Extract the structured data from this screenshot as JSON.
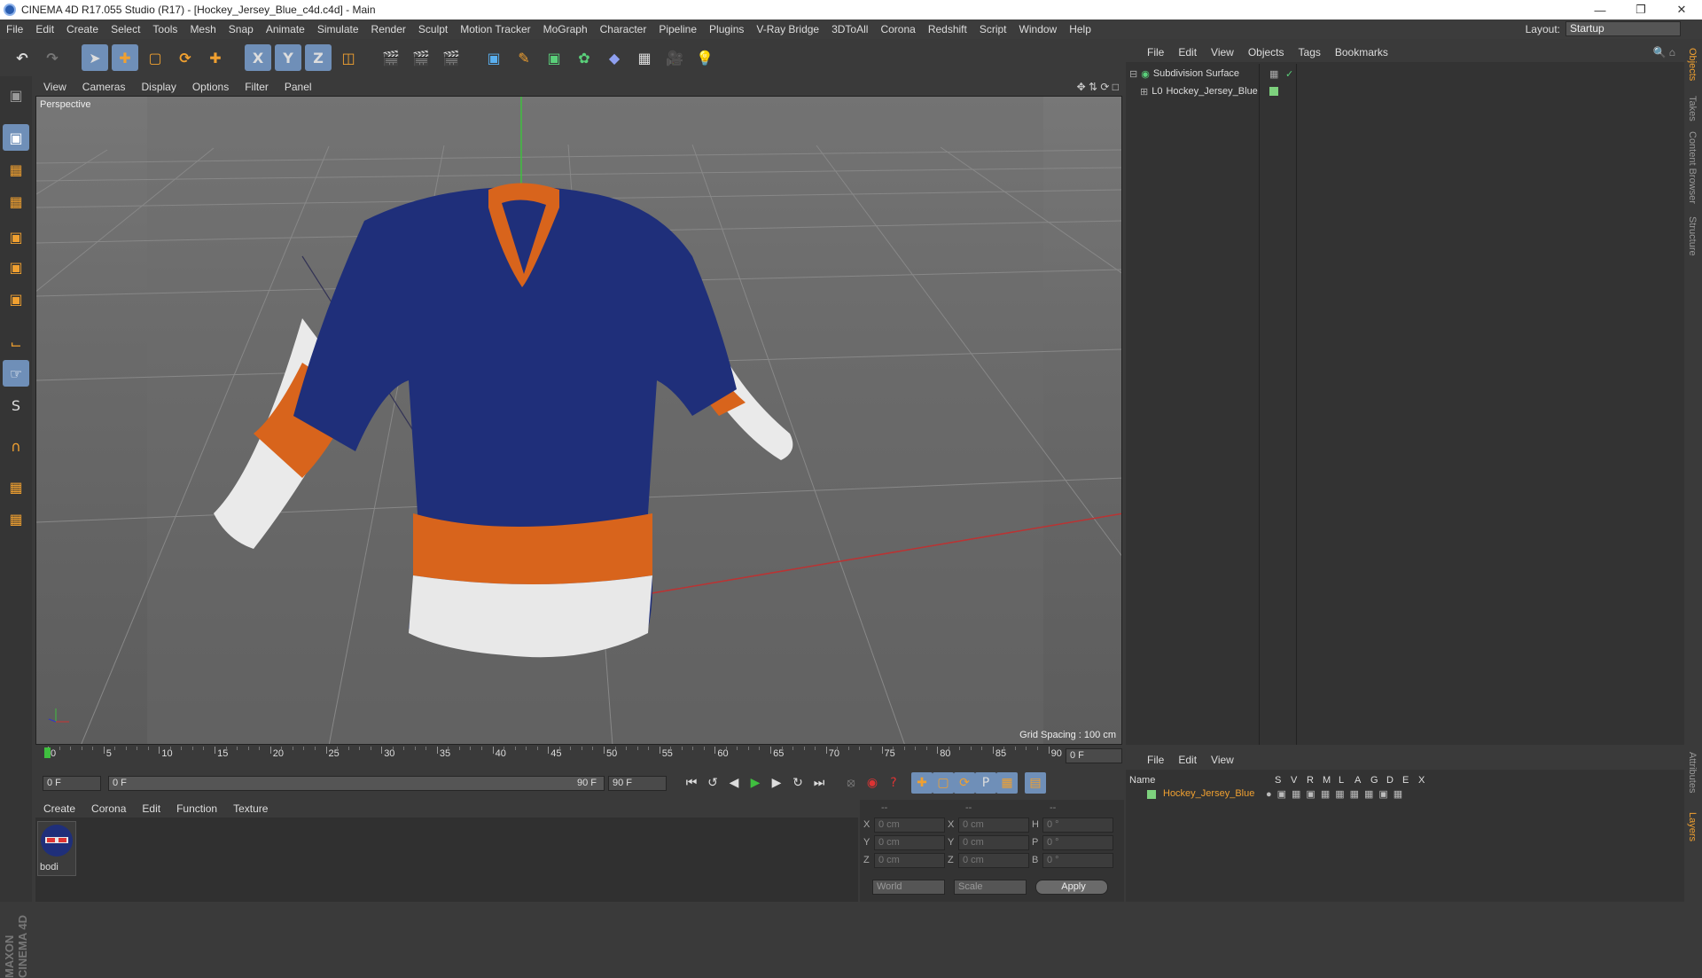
{
  "window": {
    "title": "CINEMA 4D R17.055 Studio (R17) - [Hockey_Jersey_Blue_c4d.c4d] - Main"
  },
  "menu": [
    "File",
    "Edit",
    "Create",
    "Select",
    "Tools",
    "Mesh",
    "Snap",
    "Animate",
    "Simulate",
    "Render",
    "Sculpt",
    "Motion Tracker",
    "MoGraph",
    "Character",
    "Pipeline",
    "Plugins",
    "V-Ray Bridge",
    "3DToAll",
    "Corona",
    "Redshift",
    "Script",
    "Window",
    "Help"
  ],
  "layout": {
    "label": "Layout:",
    "value": "Startup"
  },
  "viewport": {
    "menu": [
      "View",
      "Cameras",
      "Display",
      "Options",
      "Filter",
      "Panel"
    ],
    "label": "Perspective",
    "grid_spacing": "Grid Spacing : 100 cm",
    "jersey_colors": {
      "body": "#1f2f7a",
      "stripe": "#d8641c",
      "cuff": "#e8e8e8"
    }
  },
  "timeline": {
    "ticks": [
      "0",
      "5",
      "10",
      "15",
      "20",
      "25",
      "30",
      "35",
      "40",
      "45",
      "50",
      "55",
      "60",
      "65",
      "70",
      "75",
      "80",
      "85",
      "90"
    ],
    "current": "0 F"
  },
  "transport": {
    "start": "0 F",
    "range_start": "0 F",
    "range_end": "90 F",
    "end": "90 F"
  },
  "objects_panel": {
    "menu": [
      "File",
      "Edit",
      "View",
      "Objects",
      "Tags",
      "Bookmarks"
    ],
    "items": [
      {
        "name": "Subdivision Surface"
      },
      {
        "name": "Hockey_Jersey_Blue"
      }
    ]
  },
  "layers_panel": {
    "menu": [
      "File",
      "Edit",
      "View"
    ],
    "columns": [
      "Name",
      "S",
      "V",
      "R",
      "M",
      "L",
      "A",
      "G",
      "D",
      "E",
      "X"
    ],
    "rows": [
      {
        "name": "Hockey_Jersey_Blue",
        "color": "#7dd17d"
      }
    ]
  },
  "material_panel": {
    "menu": [
      "Create",
      "Corona",
      "Edit",
      "Function",
      "Texture"
    ],
    "material": {
      "name": "bodi"
    }
  },
  "coords": {
    "headers": [
      "--",
      "--",
      "--"
    ],
    "rows": [
      {
        "a": "X",
        "av": "0 cm",
        "b": "X",
        "bv": "0 cm",
        "c": "H",
        "cv": "0 °"
      },
      {
        "a": "Y",
        "av": "0 cm",
        "b": "Y",
        "bv": "0 cm",
        "c": "P",
        "cv": "0 °"
      },
      {
        "a": "Z",
        "av": "0 cm",
        "b": "Z",
        "bv": "0 cm",
        "c": "B",
        "cv": "0 °"
      }
    ],
    "world": "World",
    "scale": "Scale",
    "apply": "Apply"
  },
  "sidetabs": [
    "Objects",
    "Takes",
    "Content Browser",
    "Structure",
    "Attributes",
    "Layers"
  ],
  "brand": "MAXON CINEMA 4D"
}
